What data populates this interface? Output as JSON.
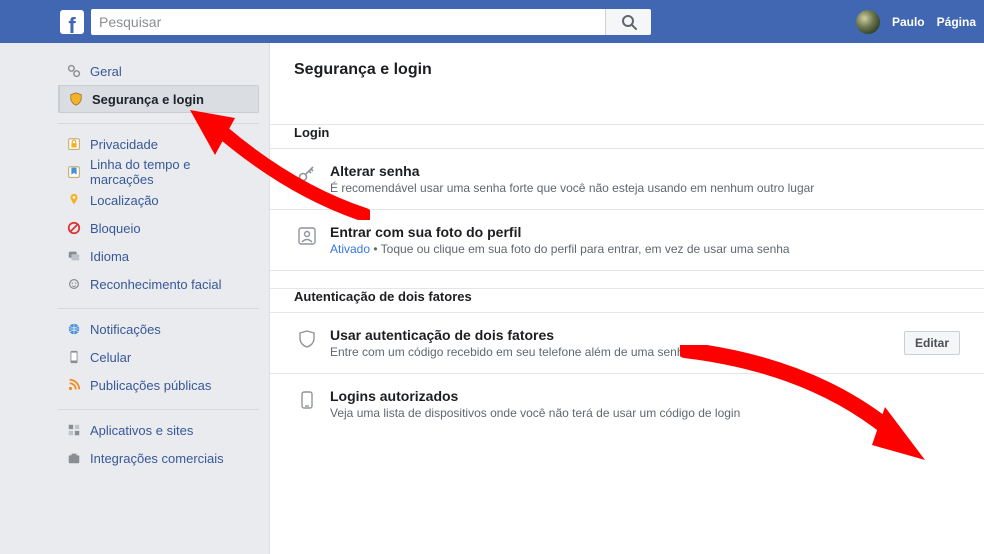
{
  "header": {
    "search_placeholder": "Pesquisar",
    "user_name": "Paulo",
    "nav_page": "Página"
  },
  "sidebar": {
    "groups": [
      [
        {
          "key": "general",
          "icon": "gear",
          "label": "Geral"
        },
        {
          "key": "security",
          "icon": "shield",
          "label": "Segurança e login",
          "selected": true
        }
      ],
      [
        {
          "key": "privacy",
          "icon": "lock-doc",
          "label": "Privacidade"
        },
        {
          "key": "timeline",
          "icon": "ribbon",
          "label": "Linha do tempo e marcações"
        },
        {
          "key": "location",
          "icon": "pin",
          "label": "Localização"
        },
        {
          "key": "blocking",
          "icon": "block",
          "label": "Bloqueio"
        },
        {
          "key": "language",
          "icon": "lang",
          "label": "Idioma"
        },
        {
          "key": "face",
          "icon": "face",
          "label": "Reconhecimento facial"
        }
      ],
      [
        {
          "key": "notifications",
          "icon": "globe",
          "label": "Notificações"
        },
        {
          "key": "mobile",
          "icon": "mobile",
          "label": "Celular"
        },
        {
          "key": "public",
          "icon": "rss",
          "label": "Publicações públicas"
        }
      ],
      [
        {
          "key": "apps",
          "icon": "apps",
          "label": "Aplicativos e sites"
        },
        {
          "key": "business",
          "icon": "business",
          "label": "Integrações comerciais"
        }
      ]
    ]
  },
  "main": {
    "title": "Segurança e login",
    "sections": [
      {
        "header": "Login",
        "rows": [
          {
            "icon": "key",
            "title": "Alterar senha",
            "sub": "É recomendável usar uma senha forte que você não esteja usando em nenhum outro lugar"
          },
          {
            "icon": "profile-photo",
            "title": "Entrar com sua foto do perfil",
            "status": "Ativado",
            "sub_after": " • Toque ou clique em sua foto do perfil para entrar, em vez de usar uma senha"
          }
        ]
      },
      {
        "header": "Autenticação de dois fatores",
        "rows": [
          {
            "icon": "shield-outline",
            "title": "Usar autenticação de dois fatores",
            "sub": "Entre com um código recebido em seu telefone além de uma senha",
            "edit_label": "Editar"
          },
          {
            "icon": "phone-outline",
            "title": "Logins autorizados",
            "sub": "Veja uma lista de dispositivos onde você não terá de usar um código de login"
          }
        ]
      }
    ]
  }
}
